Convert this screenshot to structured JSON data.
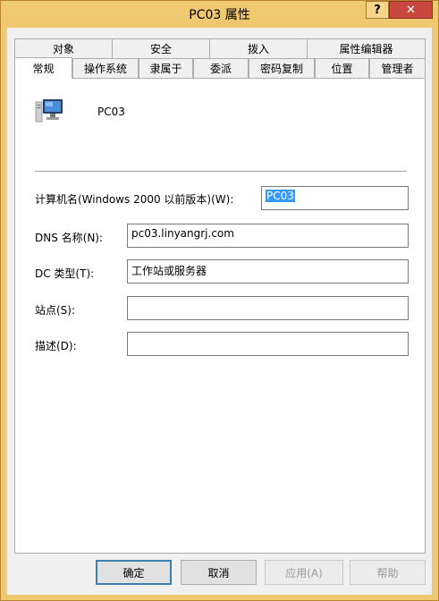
{
  "window": {
    "title": "PC03 属性",
    "help_glyph": "?",
    "close_glyph": "✕",
    "accent_color": "#f0c870",
    "close_color": "#c8483e"
  },
  "tabs_back_row": [
    "对象",
    "安全",
    "拨入",
    "属性编辑器"
  ],
  "tabs_front_row": [
    "常规",
    "操作系统",
    "隶属于",
    "委派",
    "密码复制",
    "位置",
    "管理者"
  ],
  "active_tab": "常规",
  "general": {
    "icon": "computer-icon",
    "computer_name": "PC03",
    "fields": {
      "pre2000_label": "计算机名(Windows 2000 以前版本)(W):",
      "pre2000_value": "PC03",
      "dns_label": "DNS 名称(N):",
      "dns_value": "pc03.linyangrj.com",
      "dc_type_label": "DC 类型(T):",
      "dc_type_value": "工作站或服务器",
      "site_label": "站点(S):",
      "site_value": "",
      "description_label": "描述(D):",
      "description_value": ""
    }
  },
  "buttons": {
    "ok": "确定",
    "cancel": "取消",
    "apply": "应用(A)",
    "help": "帮助"
  }
}
